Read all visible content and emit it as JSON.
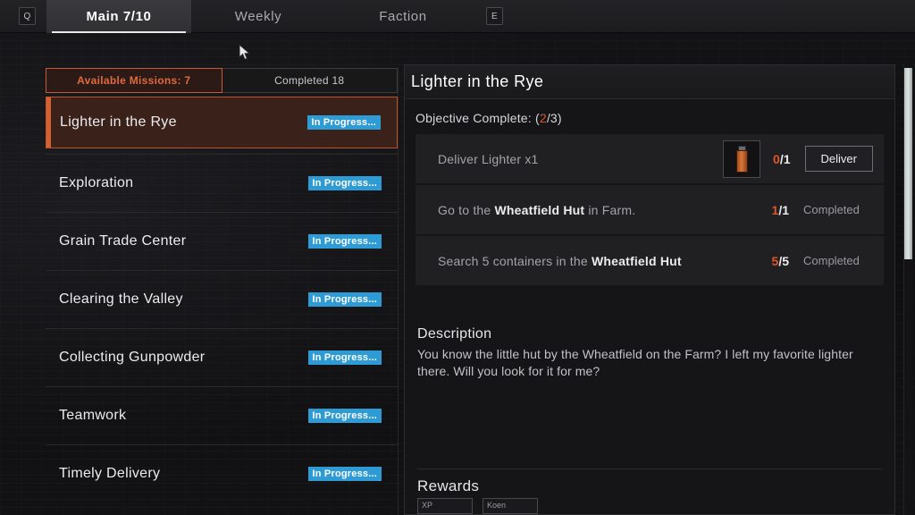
{
  "topbar": {
    "key_left": "Q",
    "key_right": "E",
    "tabs": [
      {
        "label": "Main  7/10",
        "active": true
      },
      {
        "label": "Weekly",
        "active": false
      },
      {
        "label": "Faction",
        "active": false
      }
    ]
  },
  "list_panel": {
    "tabs": [
      {
        "label": "Available Missions: 7",
        "selected": true
      },
      {
        "label": "Completed 18",
        "selected": false
      }
    ],
    "missions": [
      {
        "name": "Lighter in the Rye",
        "status": "In Progress...",
        "active": true
      },
      {
        "name": "Exploration",
        "status": "In Progress...",
        "active": false
      },
      {
        "name": "Grain Trade Center",
        "status": "In Progress...",
        "active": false
      },
      {
        "name": "Clearing the Valley",
        "status": "In Progress...",
        "active": false
      },
      {
        "name": "Collecting Gunpowder",
        "status": "In Progress...",
        "active": false
      },
      {
        "name": "Teamwork",
        "status": "In Progress...",
        "active": false
      },
      {
        "name": "Timely Delivery",
        "status": "In Progress...",
        "active": false
      }
    ]
  },
  "detail": {
    "title": "Lighter in the Rye",
    "objective_complete_label": "Objective Complete: (",
    "objective_complete_current": "2",
    "objective_complete_rest": "/3)",
    "objectives": [
      {
        "text_plain": "Deliver Lighter x1",
        "current": "0",
        "total": "/1",
        "action_label": "Deliver",
        "has_item_icon": true,
        "status": ""
      },
      {
        "text_prefix": "Go to the ",
        "text_bold": "Wheatfield Hut",
        "text_suffix": " in Farm.",
        "current": "1",
        "total": "/1",
        "status": "Completed",
        "has_item_icon": false
      },
      {
        "text_prefix": "Search 5 containers in the ",
        "text_bold": "Wheatfield Hut",
        "text_suffix": "",
        "current": "5",
        "total": "/5",
        "status": "Completed",
        "has_item_icon": false
      }
    ],
    "description_heading": "Description",
    "description_text": "You know the little hut by the Wheatfield on the Farm? I left my favorite lighter there. Will you look for it for me?",
    "rewards_heading": "Rewards",
    "rewards": [
      {
        "label": "XP"
      },
      {
        "label": "Koen"
      }
    ]
  },
  "colors": {
    "accent_orange": "#e0542a",
    "status_blue": "#2f9bd4",
    "panel_bg": "#151517"
  }
}
